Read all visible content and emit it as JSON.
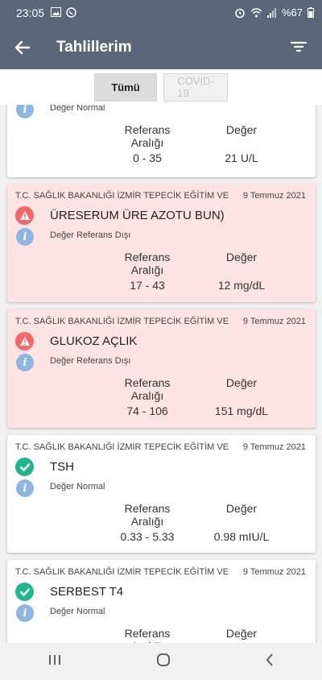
{
  "status_bar": {
    "time": "23:05",
    "battery": "%67"
  },
  "app_bar": {
    "title": "Tahlillerim"
  },
  "tabs": [
    {
      "label": "Tümü"
    },
    {
      "label": "COVID-19"
    }
  ],
  "column_headers": {
    "range": "Referans Aralığı",
    "value": "Değer"
  },
  "cards": [
    {
      "hospital": "",
      "date": "",
      "test": "",
      "status_text": "Değer Normal",
      "range": "0 - 35",
      "value": "21 U/L"
    },
    {
      "hospital": "T.C. SAĞLIK BAKANLIĞI  İZMİR TEPECİK EĞİTİM VE",
      "date": "9 Temmuz 2021",
      "test": "ÜRESERUM ÜRE AZOTU BUN)",
      "status_text": "Değer Referans Dışı",
      "range": "17 - 43",
      "value": "12 mg/dL"
    },
    {
      "hospital": "T.C. SAĞLIK BAKANLIĞI  İZMİR TEPECİK EĞİTİM VE",
      "date": "9 Temmuz 2021",
      "test": "GLUKOZ AÇLIK",
      "status_text": "Değer Referans Dışı",
      "range": "74 - 106",
      "value": "151 mg/dL"
    },
    {
      "hospital": "T.C. SAĞLIK BAKANLIĞI  İZMİR TEPECİK EĞİTİM VE",
      "date": "9 Temmuz 2021",
      "test": "TSH",
      "status_text": "Değer Normal",
      "range": "0.33 - 5.33",
      "value": "0.98 mIU/L"
    },
    {
      "hospital": "T.C. SAĞLIK BAKANLIĞI  İZMİR TEPECİK EĞİTİM VE",
      "date": "9 Temmuz 2021",
      "test": "SERBEST T4",
      "status_text": "Değer Normal",
      "range": "",
      "value": ""
    }
  ],
  "colors": {
    "app_bar": "#5b6679",
    "alert_card": "#fde3e4",
    "ok_icon": "#21b58c",
    "warn_icon": "#f0686a",
    "info_icon": "#8fb6de"
  },
  "icons": {
    "back": "arrow-left-icon",
    "filter": "filter-icon",
    "ok": "check-circle-icon",
    "warn": "warning-triangle-icon",
    "info": "info-icon"
  }
}
